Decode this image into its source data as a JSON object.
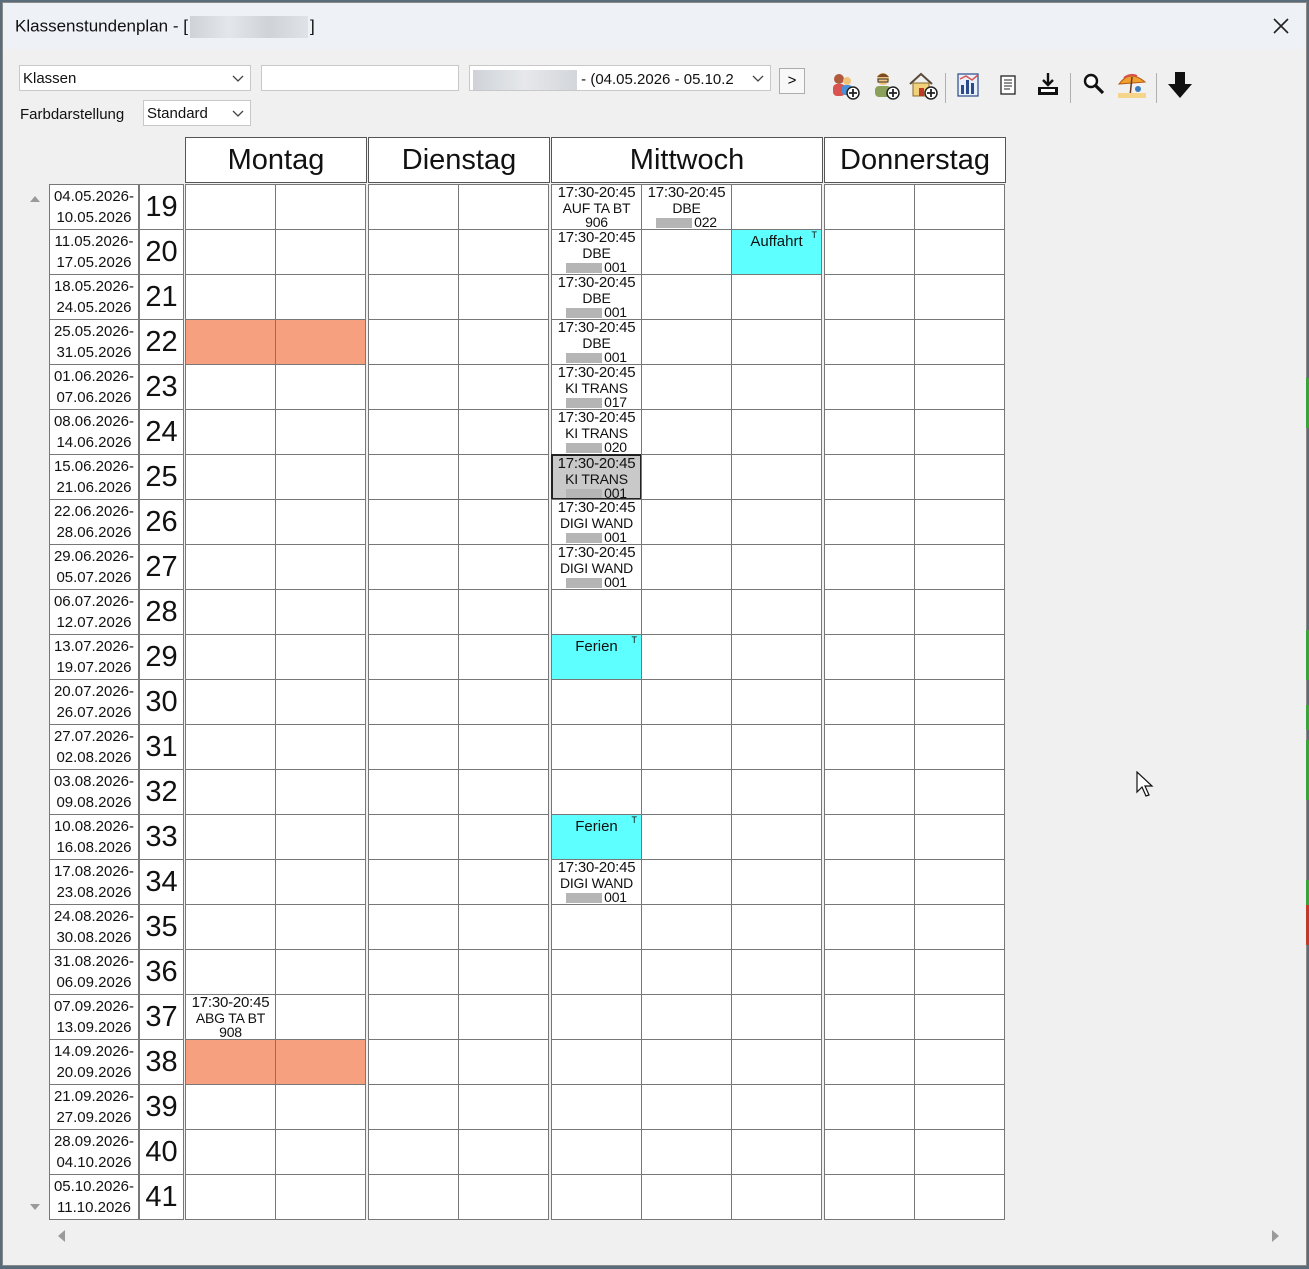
{
  "window": {
    "title_prefix": "Klassenstundenplan - [",
    "title_suffix": "]"
  },
  "toolbar": {
    "class_select": "Klassen",
    "period_range": "- (04.05.2026 - 05.10.2",
    "next_label": ">",
    "farb_label": "Farbdarstellung",
    "farb_value": "Standard",
    "icons": [
      "add-student-icon",
      "add-teacher-icon",
      "add-room-icon",
      "chart-icon",
      "document-icon",
      "download-tray-icon",
      "search-icon",
      "holiday-umbrella-icon",
      "down-arrow-icon"
    ]
  },
  "days": [
    "Montag",
    "Dienstag",
    "Mittwoch",
    "Donnerstag"
  ],
  "weeks": [
    {
      "from": "04.05.2026-",
      "to": "10.05.2026",
      "kw": "19"
    },
    {
      "from": "11.05.2026-",
      "to": "17.05.2026",
      "kw": "20"
    },
    {
      "from": "18.05.2026-",
      "to": "24.05.2026",
      "kw": "21"
    },
    {
      "from": "25.05.2026-",
      "to": "31.05.2026",
      "kw": "22"
    },
    {
      "from": "01.06.2026-",
      "to": "07.06.2026",
      "kw": "23"
    },
    {
      "from": "08.06.2026-",
      "to": "14.06.2026",
      "kw": "24"
    },
    {
      "from": "15.06.2026-",
      "to": "21.06.2026",
      "kw": "25"
    },
    {
      "from": "22.06.2026-",
      "to": "28.06.2026",
      "kw": "26"
    },
    {
      "from": "29.06.2026-",
      "to": "05.07.2026",
      "kw": "27"
    },
    {
      "from": "06.07.2026-",
      "to": "12.07.2026",
      "kw": "28"
    },
    {
      "from": "13.07.2026-",
      "to": "19.07.2026",
      "kw": "29"
    },
    {
      "from": "20.07.2026-",
      "to": "26.07.2026",
      "kw": "30"
    },
    {
      "from": "27.07.2026-",
      "to": "02.08.2026",
      "kw": "31"
    },
    {
      "from": "03.08.2026-",
      "to": "09.08.2026",
      "kw": "32"
    },
    {
      "from": "10.08.2026-",
      "to": "16.08.2026",
      "kw": "33"
    },
    {
      "from": "17.08.2026-",
      "to": "23.08.2026",
      "kw": "34"
    },
    {
      "from": "24.08.2026-",
      "to": "30.08.2026",
      "kw": "35"
    },
    {
      "from": "31.08.2026-",
      "to": "06.09.2026",
      "kw": "36"
    },
    {
      "from": "07.09.2026-",
      "to": "13.09.2026",
      "kw": "37"
    },
    {
      "from": "14.09.2026-",
      "to": "20.09.2026",
      "kw": "38"
    },
    {
      "from": "21.09.2026-",
      "to": "27.09.2026",
      "kw": "39"
    },
    {
      "from": "28.09.2026-",
      "to": "04.10.2026",
      "kw": "40"
    },
    {
      "from": "05.10.2026-",
      "to": "11.10.2026",
      "kw": "41"
    }
  ],
  "lessons": [
    {
      "week": 0,
      "col": 4,
      "time": "17:30-20:45",
      "name": "AUF TA BT",
      "room": "906",
      "blur": false
    },
    {
      "week": 0,
      "col": 5,
      "time": "17:30-20:45",
      "name": "DBE",
      "room": "022",
      "blur": true
    },
    {
      "week": 1,
      "col": 4,
      "time": "17:30-20:45",
      "name": "DBE",
      "room": "001",
      "blur": true
    },
    {
      "week": 2,
      "col": 4,
      "time": "17:30-20:45",
      "name": "DBE",
      "room": "001",
      "blur": true
    },
    {
      "week": 3,
      "col": 4,
      "time": "17:30-20:45",
      "name": "DBE",
      "room": "001",
      "blur": true
    },
    {
      "week": 4,
      "col": 4,
      "time": "17:30-20:45",
      "name": "KI TRANS",
      "room": "017",
      "blur": true
    },
    {
      "week": 5,
      "col": 4,
      "time": "17:30-20:45",
      "name": "KI TRANS",
      "room": "020",
      "blur": true
    },
    {
      "week": 6,
      "col": 4,
      "time": "17:30-20:45",
      "name": "KI TRANS",
      "room": "001",
      "blur": true,
      "selected": true
    },
    {
      "week": 7,
      "col": 4,
      "time": "17:30-20:45",
      "name": "DIGI WAND",
      "room": "001",
      "blur": true
    },
    {
      "week": 8,
      "col": 4,
      "time": "17:30-20:45",
      "name": "DIGI WAND",
      "room": "001",
      "blur": true
    },
    {
      "week": 15,
      "col": 4,
      "time": "17:30-20:45",
      "name": "DIGI WAND",
      "room": "001",
      "blur": true
    },
    {
      "week": 18,
      "col": 0,
      "time": "17:30-20:45",
      "name": "ABG TA BT",
      "room": "908",
      "blur": false
    }
  ],
  "holidays": [
    {
      "week": 1,
      "col": 6,
      "label": "Auffahrt",
      "mark": "T"
    },
    {
      "week": 10,
      "col": 4,
      "label": "Ferien",
      "mark": "T"
    },
    {
      "week": 14,
      "col": 4,
      "label": "Ferien",
      "mark": "T"
    }
  ],
  "blocked": [
    {
      "week": 3,
      "col": 0
    },
    {
      "week": 3,
      "col": 1
    },
    {
      "week": 19,
      "col": 0
    },
    {
      "week": 19,
      "col": 1
    }
  ],
  "colors": {
    "blocked": "#f7a07f",
    "holiday": "#5effff",
    "selected": "#c9c9c9"
  }
}
